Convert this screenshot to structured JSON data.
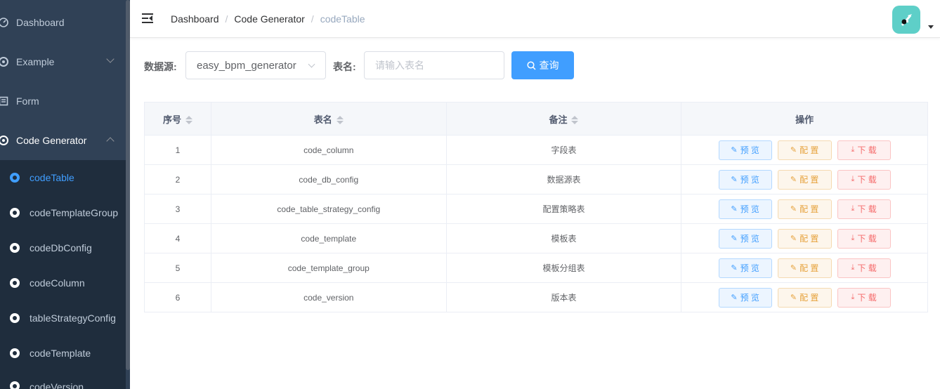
{
  "sidebar": {
    "items": [
      {
        "label": "Dashboard",
        "icon": "dashboard-icon"
      },
      {
        "label": "Example",
        "icon": "example-icon"
      },
      {
        "label": "Form",
        "icon": "form-icon"
      },
      {
        "label": "Code Generator",
        "icon": "code-generator-icon"
      }
    ],
    "children": [
      {
        "label": "codeTable",
        "active": true
      },
      {
        "label": "codeTemplateGroup"
      },
      {
        "label": "codeDbConfig"
      },
      {
        "label": "codeColumn"
      },
      {
        "label": "tableStrategyConfig"
      },
      {
        "label": "codeTemplate"
      },
      {
        "label": "codeVersion"
      }
    ]
  },
  "breadcrumb": [
    "Dashboard",
    "Code Generator",
    "codeTable"
  ],
  "search": {
    "datasource_label": "数据源:",
    "datasource_value": "easy_bpm_generator",
    "tablename_label": "表名:",
    "tablename_placeholder": "请输入表名",
    "query_button": "查询"
  },
  "table": {
    "headers": [
      "序号",
      "表名",
      "备注",
      "操作"
    ],
    "rows": [
      {
        "no": "1",
        "name": "code_column",
        "remark": "字段表"
      },
      {
        "no": "2",
        "name": "code_db_config",
        "remark": "数据源表"
      },
      {
        "no": "3",
        "name": "code_table_strategy_config",
        "remark": "配置策略表"
      },
      {
        "no": "4",
        "name": "code_template",
        "remark": "模板表"
      },
      {
        "no": "5",
        "name": "code_template_group",
        "remark": "模板分组表"
      },
      {
        "no": "6",
        "name": "code_version",
        "remark": "版本表"
      }
    ],
    "actions": {
      "preview": "预 览",
      "config": "配 置",
      "download": "下 载"
    }
  },
  "colors": {
    "sidebar_bg": "#304156",
    "submenu_bg": "#1f2d3d",
    "primary": "#409eff",
    "warning": "#e6a23c",
    "danger": "#f56c6c"
  }
}
